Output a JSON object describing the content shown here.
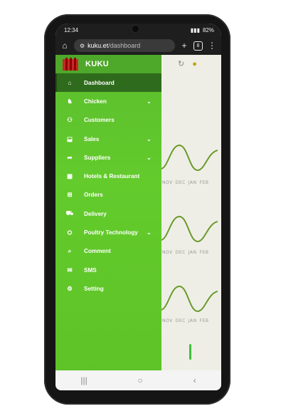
{
  "status_bar": {
    "time": "12:34",
    "battery": "82%"
  },
  "browser": {
    "url_domain": "kuku.et",
    "url_path": "/dashboard",
    "tab_count": "8"
  },
  "drawer": {
    "brand": "KUKU",
    "items": [
      {
        "label": "Dashboard",
        "icon": "home-icon",
        "active": true
      },
      {
        "label": "Chicken",
        "icon": "bird-icon",
        "expandable": true
      },
      {
        "label": "Customers",
        "icon": "users-icon"
      },
      {
        "label": "Sales",
        "icon": "sales-icon",
        "expandable": true
      },
      {
        "label": "Suppliers",
        "icon": "share-icon",
        "expandable": true
      },
      {
        "label": "Hotels & Restaurant",
        "icon": "building-icon"
      },
      {
        "label": "Orders",
        "icon": "cart-icon"
      },
      {
        "label": "Delivery",
        "icon": "truck-icon"
      },
      {
        "label": "Poultry Technology",
        "icon": "tech-icon",
        "expandable": true
      },
      {
        "label": "Comment",
        "icon": "comment-icon"
      },
      {
        "label": "SMS",
        "icon": "sms-icon"
      },
      {
        "label": "Setting",
        "icon": "gear-icon"
      }
    ]
  },
  "charts": [
    {
      "labels": [
        "NOV",
        "DEC",
        "JAN",
        "FEB"
      ]
    },
    {
      "labels": [
        "NOV",
        "DEC",
        "JAN",
        "FEB"
      ]
    },
    {
      "labels": [
        "NOV",
        "DEC",
        "JAN",
        "FEB"
      ]
    }
  ],
  "colors": {
    "drawer_green": "#5ec327",
    "active_green": "#2f6b1c",
    "line_green": "#6a9a2a"
  }
}
